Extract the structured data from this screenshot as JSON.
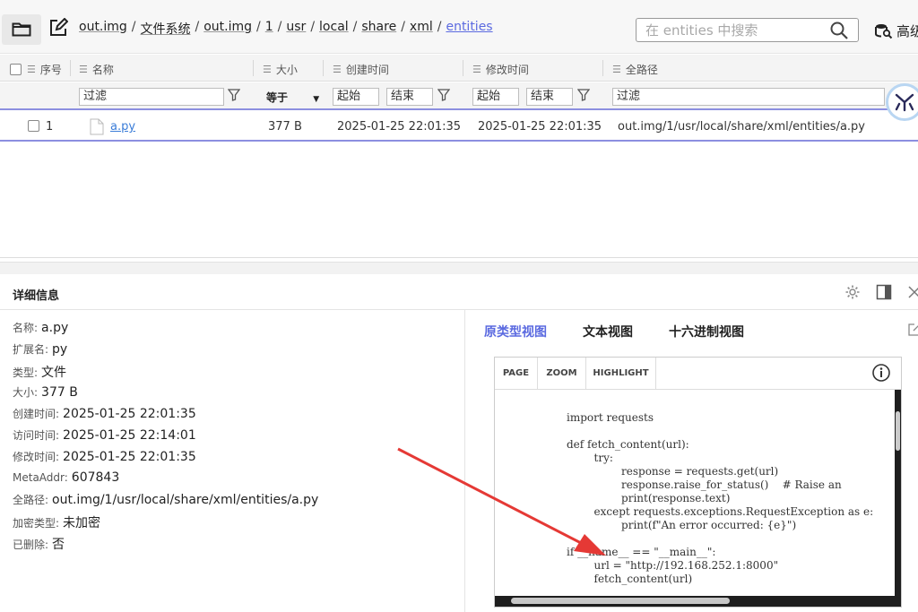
{
  "breadcrumb": [
    "out.img",
    "文件系统",
    "out.img",
    "1",
    "usr",
    "local",
    "share",
    "xml",
    "entities"
  ],
  "search": {
    "placeholder": "在 entities 中搜索"
  },
  "advanced_label": "高级",
  "table": {
    "headers": {
      "index": "序号",
      "name": "名称",
      "size": "大小",
      "created": "创建时间",
      "modified": "修改时间",
      "fullpath": "全路径"
    },
    "filters": {
      "name": "过滤",
      "size_op": "等于",
      "created_start": "起始",
      "created_end": "结束",
      "modified_start": "起始",
      "modified_end": "结束",
      "fullpath": "过滤"
    },
    "rows": [
      {
        "index": "1",
        "name": "a.py",
        "size": "377 B",
        "created": "2025-01-25 22:01:35",
        "modified": "2025-01-25 22:01:35",
        "fullpath": "out.img/1/usr/local/share/xml/entities/a.py"
      }
    ]
  },
  "details": {
    "title": "详细信息",
    "props": [
      {
        "label": "名称:",
        "value": "a.py"
      },
      {
        "label": "扩展名:",
        "value": "py"
      },
      {
        "label": "类型:",
        "value": "文件"
      },
      {
        "label": "大小:",
        "value": "377 B"
      },
      {
        "label": "创建时间:",
        "value": "2025-01-25 22:01:35"
      },
      {
        "label": "访问时间:",
        "value": "2025-01-25 22:14:01"
      },
      {
        "label": "修改时间:",
        "value": "2025-01-25 22:01:35"
      },
      {
        "label": "MetaAddr:",
        "value": "607843"
      },
      {
        "label": "全路径:",
        "value": "out.img/1/usr/local/share/xml/entities/a.py"
      },
      {
        "label": "加密类型:",
        "value": "未加密"
      },
      {
        "label": "已删除:",
        "value": "否"
      }
    ]
  },
  "preview": {
    "tabs": [
      "原类型视图",
      "文本视图",
      "十六进制视图"
    ],
    "toolbar": [
      "PAGE",
      "ZOOM",
      "HIGHLIGHT"
    ],
    "code": "import requests\n\ndef fetch_content(url):\n        try:\n                response = requests.get(url)\n                response.raise_for_status()    # Raise an\n                print(response.text)\n        except requests.exceptions.RequestException as e:\n                print(f\"An error occurred: {e}\")\n\nif __name__ == \"__main__\":\n        url = \"http://192.168.252.1:8000\"\n        fetch_content(url)"
  },
  "colors": {
    "accent": "#5b6ae0",
    "arrow": "#e53935"
  }
}
